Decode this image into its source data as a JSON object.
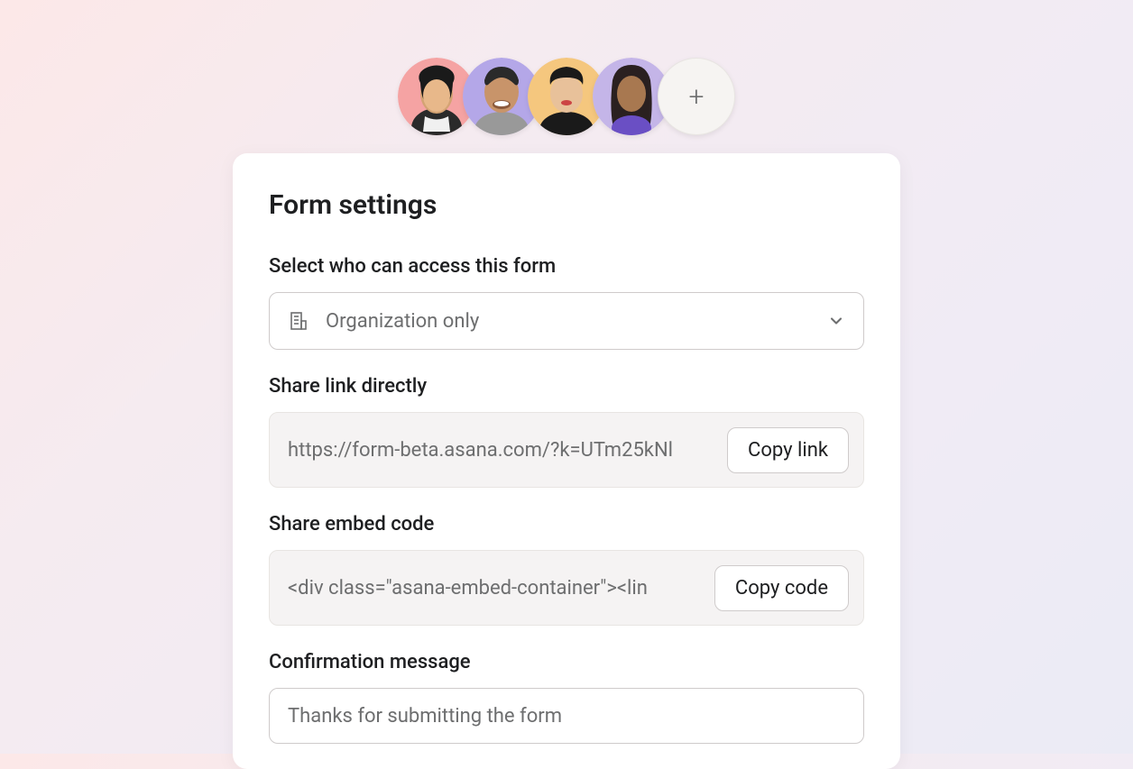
{
  "avatars": {
    "add_icon": "+"
  },
  "card": {
    "title": "Form settings",
    "access": {
      "label": "Select who can access this form",
      "selected": "Organization only"
    },
    "share_link": {
      "label": "Share link directly",
      "value": "https://form-beta.asana.com/?k=UTm25kNl",
      "button": "Copy link"
    },
    "embed": {
      "label": "Share embed code",
      "value": "<div class=\"asana-embed-container\"><lin",
      "button": "Copy code"
    },
    "confirmation": {
      "label": "Confirmation message",
      "value": "Thanks for submitting the form"
    }
  }
}
